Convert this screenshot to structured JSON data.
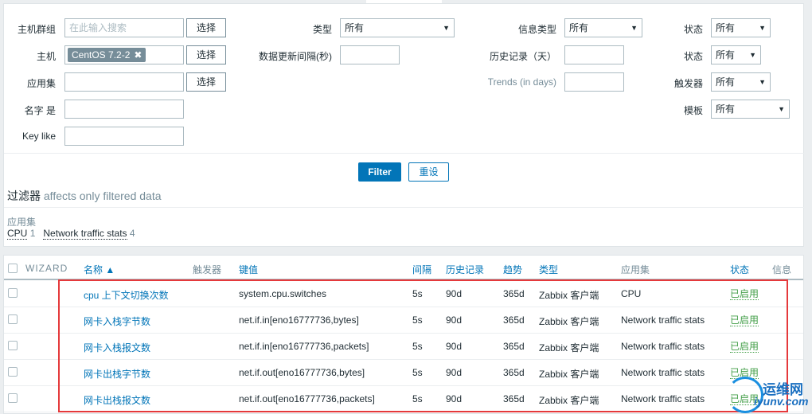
{
  "filter": {
    "host_group": {
      "label": "主机群组",
      "placeholder": "在此输入搜索",
      "select": "选择"
    },
    "host": {
      "label": "主机",
      "chip": "CentOS 7.2-2",
      "chip_close": "✖",
      "select": "选择"
    },
    "application": {
      "label": "应用集",
      "value": "",
      "select": "选择"
    },
    "name": {
      "label": "名字 是",
      "value": ""
    },
    "key": {
      "label": "Key like",
      "value": ""
    },
    "type": {
      "label": "类型",
      "value": "所有"
    },
    "update_interval": {
      "label": "数据更新间隔(秒)",
      "value": ""
    },
    "info_type": {
      "label": "信息类型",
      "value": "所有"
    },
    "history": {
      "label": "历史记录（天）",
      "value": ""
    },
    "trends": {
      "label": "Trends (in days)",
      "value": ""
    },
    "state": {
      "label": "状态",
      "value": "所有"
    },
    "status": {
      "label": "状态",
      "value": "所有"
    },
    "triggers": {
      "label": "触发器",
      "value": "所有"
    },
    "template": {
      "label": "模板",
      "value": "所有"
    },
    "filter_button": "Filter",
    "reset_button": "重设"
  },
  "subfilter": {
    "title": "过滤器",
    "note": "affects only filtered data",
    "group_label": "应用集",
    "items": [
      {
        "label": "CPU",
        "count": "1"
      },
      {
        "label": "Network traffic stats",
        "count": "4"
      }
    ]
  },
  "table": {
    "headers": {
      "wizard": "WIZARD",
      "name": "名称 ▲",
      "triggers": "触发器",
      "key": "键值",
      "interval": "间隔",
      "history": "历史记录",
      "trends": "趋势",
      "type": "类型",
      "applications": "应用集",
      "status": "状态",
      "info": "信息"
    },
    "rows": [
      {
        "name": "cpu 上下文切换次数",
        "key": "system.cpu.switches",
        "interval": "5s",
        "history": "90d",
        "trends": "365d",
        "type": "Zabbix 客户端",
        "application": "CPU",
        "status": "已启用"
      },
      {
        "name": "网卡入栈字节数",
        "key": "net.if.in[eno16777736,bytes]",
        "interval": "5s",
        "history": "90d",
        "trends": "365d",
        "type": "Zabbix 客户端",
        "application": "Network traffic stats",
        "status": "已启用"
      },
      {
        "name": "网卡入栈报文数",
        "key": "net.if.in[eno16777736,packets]",
        "interval": "5s",
        "history": "90d",
        "trends": "365d",
        "type": "Zabbix 客户端",
        "application": "Network traffic stats",
        "status": "已启用"
      },
      {
        "name": "网卡出栈字节数",
        "key": "net.if.out[eno16777736,bytes]",
        "interval": "5s",
        "history": "90d",
        "trends": "365d",
        "type": "Zabbix 客户端",
        "application": "Network traffic stats",
        "status": "已启用"
      },
      {
        "name": "网卡出栈报文数",
        "key": "net.if.out[eno16777736,packets]",
        "interval": "5s",
        "history": "90d",
        "trends": "365d",
        "type": "Zabbix 客户端",
        "application": "Network traffic stats",
        "status": "已启用"
      }
    ]
  },
  "watermark": {
    "cn": "运维网",
    "en": "iyunv.com"
  },
  "colors": {
    "accent": "#0275b8",
    "enabled": "#429e47",
    "highlight_box": "#e5393b"
  }
}
